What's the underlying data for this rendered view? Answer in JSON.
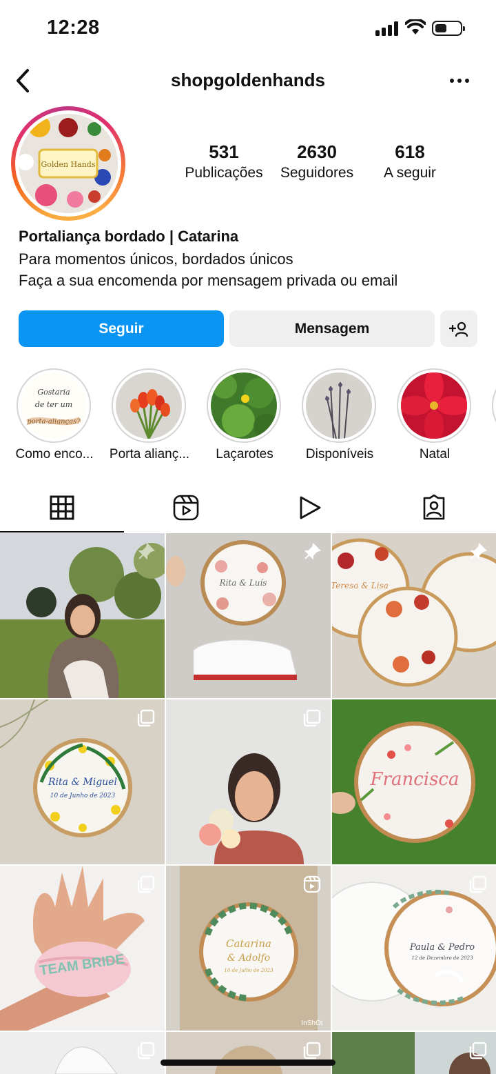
{
  "status_bar": {
    "time": "12:28"
  },
  "header": {
    "username": "shopgoldenhands"
  },
  "profile": {
    "avatar_text": "Golden Hands",
    "stats": [
      {
        "value": "531",
        "label": "Publicações"
      },
      {
        "value": "2630",
        "label": "Seguidores"
      },
      {
        "value": "618",
        "label": "A seguir"
      }
    ],
    "bio_name": "Portaliança bordado | Catarina",
    "bio_lines": [
      "Para momentos únicos, bordados únicos",
      "Faça a sua encomenda por mensagem privada ou email"
    ]
  },
  "actions": {
    "follow_label": "Seguir",
    "message_label": "Mensagem"
  },
  "highlights": [
    {
      "label": "Como enco...",
      "cover_text": [
        "Gostaria",
        "de ter um",
        "porta-alianças?"
      ]
    },
    {
      "label": "Porta alianç..."
    },
    {
      "label": "Laçarotes"
    },
    {
      "label": "Disponíveis"
    },
    {
      "label": "Natal"
    }
  ],
  "tabs": [
    "grid",
    "reels",
    "video",
    "tagged"
  ],
  "grid_text": {
    "p2": "Rita & Luís",
    "p3": "Teresa & Lisa",
    "p4_a": "Rita & Miguel",
    "p4_b": "10 de Junho de 2023",
    "p6": "Francisca",
    "p7": "TEAM BRIDE",
    "p8_a": "Catarina",
    "p8_b": "& Adolfo",
    "p8_c": "10 de Julho de 2023",
    "p8_watermark": "InShOt",
    "p9_a": "Paula & Pedro",
    "p9_b": "12 de Dezembro de 2023"
  }
}
